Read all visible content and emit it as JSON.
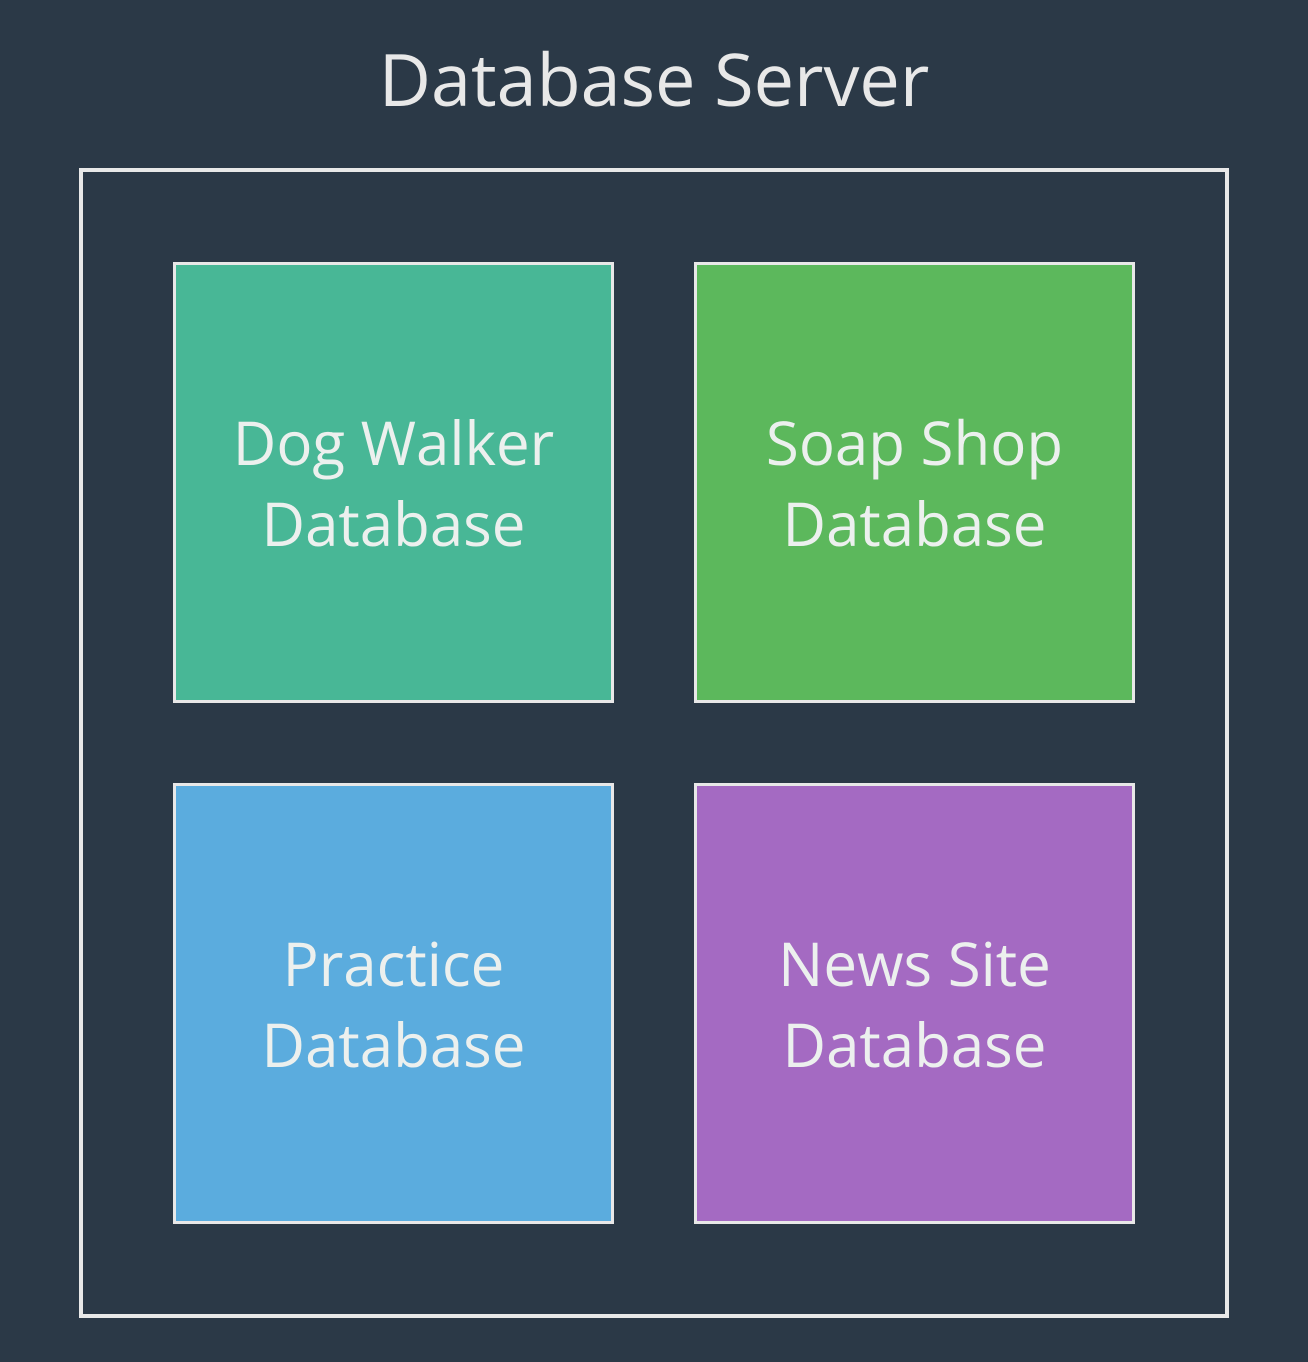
{
  "title": "Database Server",
  "databases": [
    {
      "label_line1": "Dog Walker",
      "label_line2": "Database",
      "color": "#48b796"
    },
    {
      "label_line1": "Soap Shop",
      "label_line2": "Database",
      "color": "#5cb85c"
    },
    {
      "label_line1": "Practice",
      "label_line2": "Database",
      "color": "#5bacde"
    },
    {
      "label_line1": "News Site",
      "label_line2": "Database",
      "color": "#a46ac2"
    }
  ]
}
